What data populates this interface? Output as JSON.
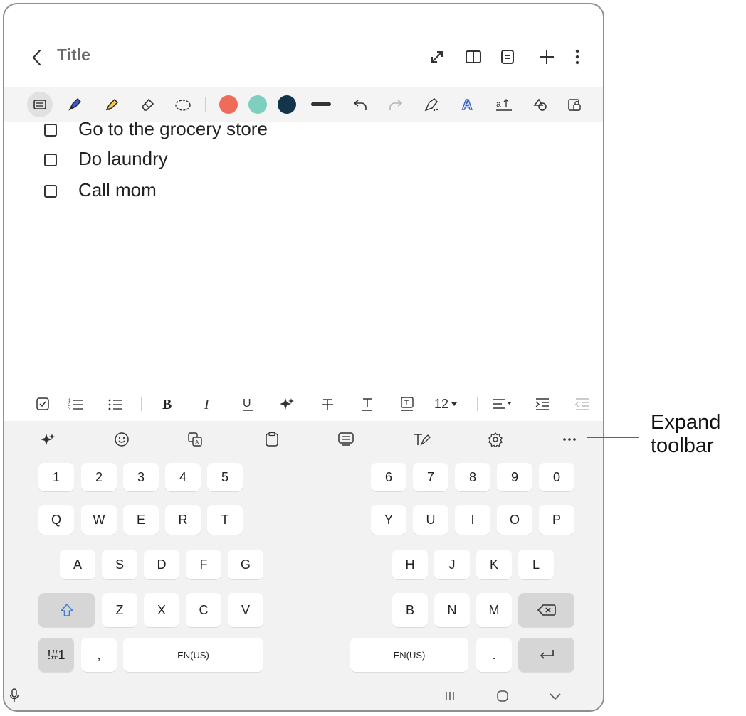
{
  "header": {
    "title": "Title"
  },
  "pen_toolbar": {
    "color_swatches": [
      "#ef6c5a",
      "#7ecfc0",
      "#13344a"
    ]
  },
  "note": {
    "items": [
      {
        "label": "Go to the grocery store",
        "checked": false
      },
      {
        "label": "Do laundry",
        "checked": false
      },
      {
        "label": "Call mom",
        "checked": false
      }
    ]
  },
  "format_toolbar": {
    "font_size": "12"
  },
  "keyboard": {
    "row_numbers_left": [
      "1",
      "2",
      "3",
      "4",
      "5"
    ],
    "row_numbers_right": [
      "6",
      "7",
      "8",
      "9",
      "0"
    ],
    "row_q_left": [
      "Q",
      "W",
      "E",
      "R",
      "T"
    ],
    "row_q_right": [
      "Y",
      "U",
      "I",
      "O",
      "P"
    ],
    "row_a_left": [
      "A",
      "S",
      "D",
      "F",
      "G"
    ],
    "row_a_right": [
      "H",
      "J",
      "K",
      "L"
    ],
    "row_z_left": [
      "Z",
      "X",
      "C",
      "V"
    ],
    "row_z_right": [
      "B",
      "N",
      "M"
    ],
    "symbols_key": "!#1",
    "comma_key": ",",
    "space_left_label": "EN(US)",
    "space_right_label": "EN(US)",
    "period_key": "."
  },
  "callout": {
    "line1": "Expand",
    "line2": "toolbar"
  },
  "colors": {
    "accent": "#2a6fb0",
    "shift": "#3a7bd5"
  }
}
